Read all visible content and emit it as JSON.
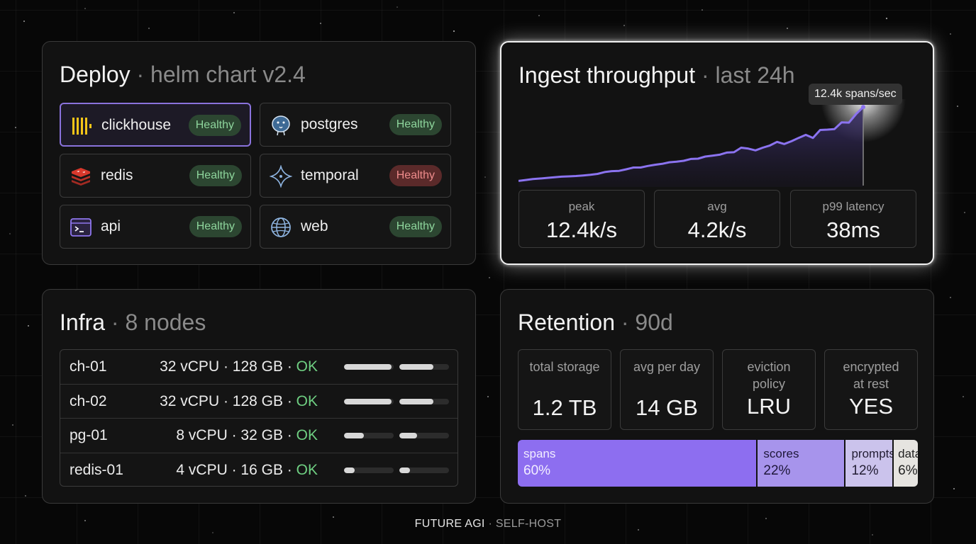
{
  "deploy": {
    "title": "Deploy",
    "subtitle": "helm chart v2.4",
    "services": [
      {
        "name": "clickhouse",
        "status": "Healthy",
        "icon": "clickhouse-icon",
        "state": "ok",
        "selected": true
      },
      {
        "name": "postgres",
        "status": "Healthy",
        "icon": "postgres-icon",
        "state": "ok"
      },
      {
        "name": "redis",
        "status": "Healthy",
        "icon": "redis-icon",
        "state": "ok"
      },
      {
        "name": "temporal",
        "status": "Healthy",
        "icon": "temporal-icon",
        "state": "bad"
      },
      {
        "name": "api",
        "status": "Healthy",
        "icon": "terminal-icon",
        "state": "ok"
      },
      {
        "name": "web",
        "status": "Healthy",
        "icon": "globe-icon",
        "state": "ok"
      }
    ]
  },
  "throughput": {
    "title": "Ingest throughput",
    "subtitle": "last 24h",
    "tooltip": "12.4k spans/sec",
    "stats": [
      {
        "label": "peak",
        "value": "12.4k/s"
      },
      {
        "label": "avg",
        "value": "4.2k/s"
      },
      {
        "label": "p99 latency",
        "value": "38ms"
      }
    ]
  },
  "chart_data": {
    "type": "area",
    "title": "Ingest throughput",
    "xlabel": "",
    "ylabel": "",
    "ylim": [
      0,
      13
    ],
    "x": [
      0,
      1,
      2,
      3,
      4,
      5,
      6,
      7,
      8,
      9,
      10,
      11,
      12,
      13,
      14,
      15,
      16,
      17,
      18,
      19,
      20,
      21,
      22,
      23,
      24,
      25,
      26,
      27,
      28,
      29,
      30,
      31,
      32,
      33,
      34,
      35,
      36,
      37,
      38,
      39,
      40,
      41,
      42,
      43,
      44,
      45,
      46,
      47,
      48
    ],
    "series": [
      {
        "values": [
          0.3,
          0.45,
          0.6,
          0.7,
          0.8,
          0.9,
          1.0,
          1.05,
          1.1,
          1.2,
          1.3,
          1.45,
          1.75,
          1.9,
          1.95,
          2.2,
          2.5,
          2.5,
          2.75,
          2.95,
          3.1,
          3.35,
          3.45,
          3.6,
          3.9,
          3.95,
          4.3,
          4.45,
          4.6,
          4.95,
          5.0,
          5.75,
          5.6,
          5.3,
          5.75,
          6.1,
          6.7,
          6.35,
          6.8,
          7.35,
          7.85,
          7.35,
          8.65,
          8.7,
          8.8,
          9.9,
          9.85,
          11.25,
          12.4
        ]
      }
    ],
    "highlight": {
      "x": 48,
      "y": 12.4,
      "label": "12.4k spans/sec"
    },
    "grid": false,
    "legend": "none",
    "colors": {
      "line": "#8b73f0",
      "fill": "#2a2148"
    }
  },
  "infra": {
    "title": "Infra",
    "subtitle": "8 nodes",
    "nodes": [
      {
        "name": "ch-01",
        "spec": "32 vCPU · 128 GB ·",
        "status": "OK",
        "cpu": 0.96,
        "mem": 0.68
      },
      {
        "name": "ch-02",
        "spec": "32 vCPU · 128 GB ·",
        "status": "OK",
        "cpu": 0.96,
        "mem": 0.68
      },
      {
        "name": "pg-01",
        "spec": "8 vCPU · 32 GB ·",
        "status": "OK",
        "cpu": 0.4,
        "mem": 0.36
      },
      {
        "name": "redis-01",
        "spec": "4 vCPU · 16 GB ·",
        "status": "OK",
        "cpu": 0.22,
        "mem": 0.22
      }
    ]
  },
  "retention": {
    "title": "Retention",
    "subtitle": "90d",
    "stats": [
      {
        "label": "total storage",
        "value": "1.2 TB"
      },
      {
        "label": "avg per day",
        "value": "14 GB"
      },
      {
        "label": "eviction policy",
        "value": "LRU"
      },
      {
        "label": "encrypted at rest",
        "value": "YES"
      }
    ],
    "breakdown": [
      {
        "name": "spans",
        "pct": "60%",
        "share": 0.6,
        "color": "#8d6ef0",
        "text": "#f2eeff"
      },
      {
        "name": "scores",
        "pct": "22%",
        "share": 0.22,
        "color": "#a794ec",
        "text": "#1e173a"
      },
      {
        "name": "prompts",
        "pct": "12%",
        "share": 0.12,
        "color": "#cbc3ec",
        "text": "#221d33"
      },
      {
        "name": "data",
        "pct": "6%",
        "share": 0.06,
        "color": "#e6e4e0",
        "text": "#232323"
      }
    ]
  },
  "footer": {
    "brand": "FUTURE AGI",
    "sep": "·",
    "tag": "SELF-HOST"
  }
}
